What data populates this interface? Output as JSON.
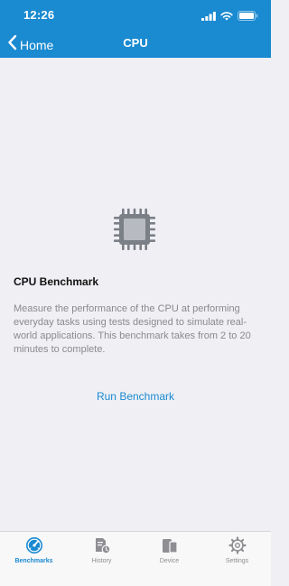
{
  "status_bar": {
    "time": "12:26",
    "icons": [
      "signal-icon",
      "wifi-icon",
      "battery-icon"
    ]
  },
  "nav": {
    "back_label": "Home",
    "title": "CPU"
  },
  "main": {
    "icon": "cpu-chip-icon",
    "title": "CPU Benchmark",
    "description": "Measure the performance of the CPU at performing everyday tasks using tests designed to simulate real-world applications. This benchmark takes from 2 to 20 minutes to complete.",
    "run_label": "Run Benchmark"
  },
  "tabs": [
    {
      "label": "Benchmarks",
      "icon": "speedometer-icon",
      "active": true
    },
    {
      "label": "History",
      "icon": "history-document-icon",
      "active": false
    },
    {
      "label": "Device",
      "icon": "device-icon",
      "active": false
    },
    {
      "label": "Settings",
      "icon": "gear-icon",
      "active": false
    }
  ],
  "colors": {
    "accent": "#1a8ad1",
    "background": "#efeff4",
    "secondary_text": "#8a8a8e",
    "inactive_tab": "#8e8e93"
  }
}
